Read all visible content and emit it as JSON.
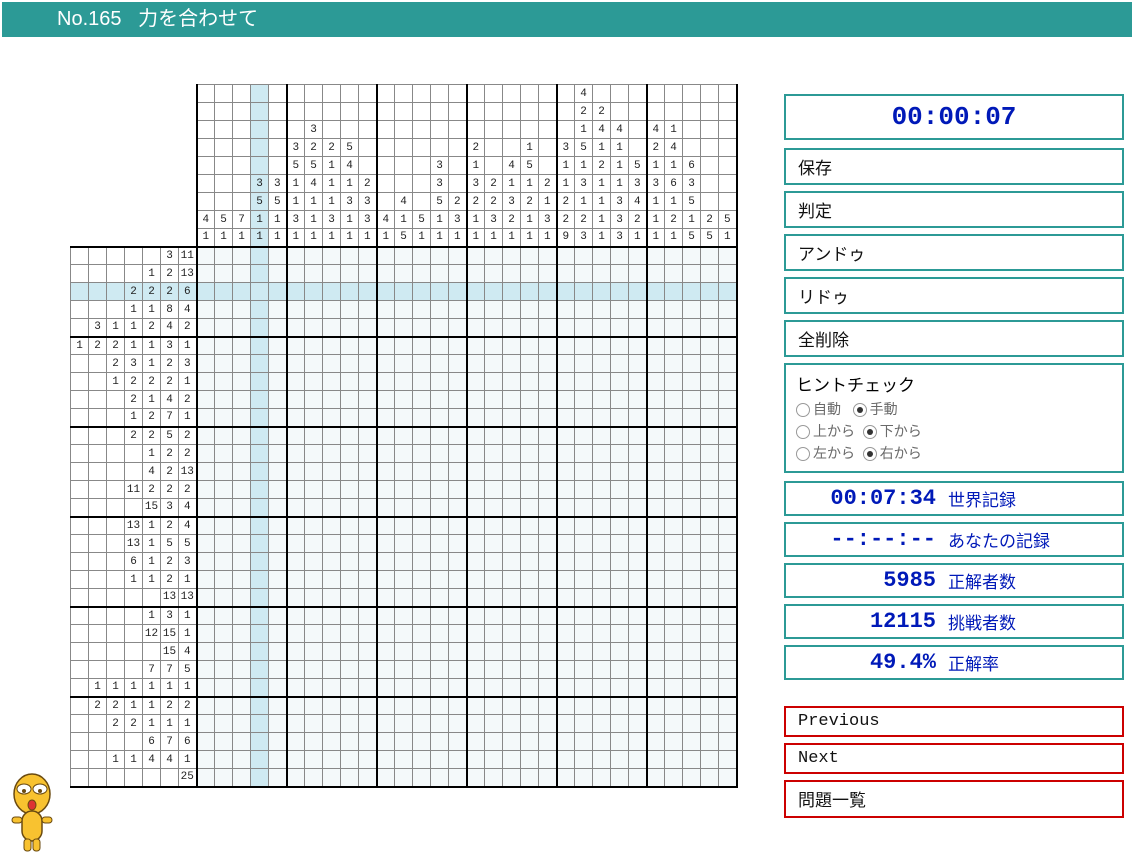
{
  "header": {
    "number": "No.165",
    "title": "力を合わせて"
  },
  "timer": "00:00:07",
  "buttons": {
    "save": "保存",
    "judge": "判定",
    "undo": "アンドゥ",
    "redo": "リドゥ",
    "clear": "全削除"
  },
  "hint": {
    "title": "ヒントチェック",
    "auto": "自動",
    "manual": "手動",
    "top": "上から",
    "bottom": "下から",
    "left": "左から",
    "right": "右から"
  },
  "stats": {
    "world_time": "00:07:34",
    "world_label": "世界記録",
    "your_time": "--:--:--",
    "your_label": "あなたの記録",
    "correct_count": "5985",
    "correct_label": "正解者数",
    "challenge_count": "12115",
    "challenge_label": "挑戦者数",
    "rate": "49.4%",
    "rate_label": "正解率"
  },
  "nav": {
    "prev": "Previous",
    "next": "Next",
    "list": "問題一覧"
  },
  "grid": {
    "width": 30,
    "height": 30,
    "top_clue_rows": 9,
    "left_clue_cols": 7,
    "highlight_row": 2,
    "highlight_col": 3,
    "col_clues": [
      [
        4,
        1
      ],
      [
        5,
        1
      ],
      [
        7,
        1
      ],
      [
        3,
        5,
        1,
        1
      ],
      [
        3,
        5,
        1,
        1
      ],
      [
        3,
        5,
        1,
        1,
        3,
        1
      ],
      [
        3,
        2,
        5,
        4,
        1,
        1,
        1
      ],
      [
        2,
        1,
        1,
        1,
        3,
        1
      ],
      [
        5,
        4,
        1,
        3,
        1,
        1
      ],
      [
        2,
        3,
        3,
        1
      ],
      [
        4,
        1
      ],
      [
        4,
        1,
        5
      ],
      [
        5,
        1
      ],
      [
        3,
        3,
        5,
        1,
        1
      ],
      [
        2,
        3,
        1
      ],
      [
        2,
        1,
        3,
        2,
        1,
        1
      ],
      [
        2,
        2,
        3,
        1
      ],
      [
        4,
        1,
        3,
        2,
        1
      ],
      [
        1,
        5,
        1,
        2,
        1,
        1
      ],
      [
        2,
        1,
        3,
        1
      ],
      [
        3,
        1,
        1,
        2,
        2,
        9
      ],
      [
        4,
        2,
        1,
        5,
        1,
        3,
        1,
        2,
        3
      ],
      [
        2,
        4,
        1,
        2,
        1,
        1,
        1,
        1
      ],
      [
        4,
        1,
        1,
        1,
        3,
        3,
        3
      ],
      [
        5,
        3,
        4,
        2,
        1
      ],
      [
        4,
        2,
        1,
        3,
        1,
        1,
        1
      ],
      [
        1,
        4,
        1,
        6,
        1,
        2,
        1
      ],
      [
        6,
        3,
        5,
        1,
        5
      ],
      [
        2,
        5
      ],
      [
        5,
        1
      ]
    ],
    "row_clues": [
      [
        3,
        11
      ],
      [
        1,
        2,
        13
      ],
      [
        2,
        2,
        2,
        6
      ],
      [
        1,
        1,
        8,
        4
      ],
      [
        3,
        1,
        1,
        2,
        4,
        2
      ],
      [
        1,
        2,
        2,
        1,
        1,
        3,
        1
      ],
      [
        2,
        3,
        1,
        2,
        3
      ],
      [
        1,
        2,
        2,
        2,
        1
      ],
      [
        2,
        1,
        4,
        2
      ],
      [
        1,
        2,
        7,
        1
      ],
      [
        2,
        2,
        5,
        2
      ],
      [
        1,
        2,
        2
      ],
      [
        4,
        2,
        13
      ],
      [
        11,
        2,
        2,
        2
      ],
      [
        15,
        3,
        4
      ],
      [
        13,
        1,
        2,
        4
      ],
      [
        13,
        1,
        5,
        5
      ],
      [
        6,
        1,
        2,
        3
      ],
      [
        1,
        1,
        2,
        1
      ],
      [
        13,
        13
      ],
      [
        1,
        3,
        1
      ],
      [
        12,
        15,
        1
      ],
      [
        15,
        4
      ],
      [
        7,
        7,
        5
      ],
      [
        1,
        1,
        1,
        1,
        1,
        1
      ],
      [
        2,
        2,
        1,
        1,
        2,
        2
      ],
      [
        2,
        2,
        1,
        1,
        1
      ],
      [
        6,
        7,
        6
      ],
      [
        1,
        1,
        4,
        4,
        1
      ],
      [
        25
      ]
    ]
  }
}
